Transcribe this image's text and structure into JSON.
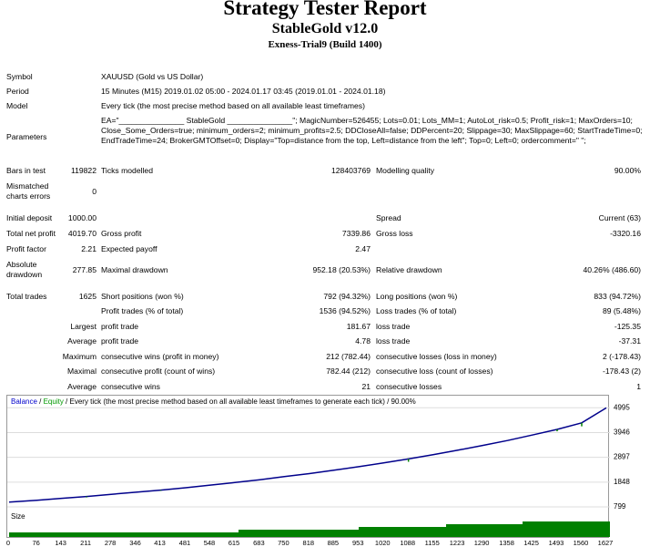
{
  "header": {
    "title": "Strategy Tester Report",
    "subtitle": "StableGold v12.0",
    "build": "Exness-Trial9 (Build 1400)"
  },
  "info": {
    "symbol_label": "Symbol",
    "symbol": "XAUUSD (Gold vs US Dollar)",
    "period_label": "Period",
    "period": "15 Minutes (M15) 2019.01.02 05:00 - 2024.01.17 03:45 (2019.01.01 - 2024.01.18)",
    "model_label": "Model",
    "model": "Every tick (the most precise method based on all available least timeframes)",
    "parameters_label": "Parameters",
    "parameters": "EA=\"_______________ StableGold _______________\"; MagicNumber=526455; Lots=0.01; Lots_MM=1; AutoLot_risk=0.5; Profit_risk=1; MaxOrders=10; Close_Some_Orders=true; minimum_orders=2; minimum_profits=2.5; DDCloseAll=false; DDPercent=20; Slippage=30; MaxSlippage=60; StartTradeTime=0; EndTradeTime=24; BrokerGMTOffset=0; Display=\"Top=distance from the top, Left=distance from the left\"; Top=0; Left=0; ordercomment=\" \";"
  },
  "stats": {
    "bars_label": "Bars in test",
    "bars": "119822",
    "ticks_label": "Ticks modelled",
    "ticks": "128403769",
    "quality_label": "Modelling quality",
    "quality": "90.00%",
    "mismatched_label_1": "Mismatched",
    "mismatched_label_2": "charts errors",
    "mismatched": "0",
    "deposit_label": "Initial deposit",
    "deposit": "1000.00",
    "spread_label": "Spread",
    "spread": "Current (63)",
    "net_label": "Total net profit",
    "net": "4019.70",
    "gross_profit_label": "Gross profit",
    "gross_profit": "7339.86",
    "gross_loss_label": "Gross loss",
    "gross_loss": "-3320.16",
    "pf_label": "Profit factor",
    "pf": "2.21",
    "payoff_label": "Expected payoff",
    "payoff": "2.47",
    "abs_dd_label_1": "Absolute",
    "abs_dd_label_2": "drawdown",
    "abs_dd": "277.85",
    "max_dd_label": "Maximal drawdown",
    "max_dd": "952.18 (20.53%)",
    "rel_dd_label": "Relative drawdown",
    "rel_dd": "40.26% (486.60)",
    "trades_label": "Total trades",
    "trades": "1625",
    "short_label": "Short positions (won %)",
    "short": "792 (94.32%)",
    "long_label": "Long positions (won %)",
    "long": "833 (94.72%)",
    "pt_label": "Profit trades (% of total)",
    "pt": "1536 (94.52%)",
    "lt_label": "Loss trades (% of total)",
    "lt": "89 (5.48%)",
    "largest_label": "Largest",
    "average_label": "Average",
    "maximum_label": "Maximum",
    "maximal_label": "Maximal",
    "profit_trade_label": "profit trade",
    "loss_trade_label": "loss trade",
    "largest_profit": "181.67",
    "largest_loss": "-125.35",
    "average_profit": "4.78",
    "average_loss": "-37.31",
    "cw_label": "consecutive wins (profit in money)",
    "cw": "212 (782.44)",
    "cl_label": "consecutive losses (loss in money)",
    "cl": "2 (-178.43)",
    "cp_label": "consecutive profit (count of wins)",
    "cp": "782.44 (212)",
    "closs_label": "consecutive loss (count of losses)",
    "closs": "-178.43 (2)",
    "acw_label": "consecutive wins",
    "acw": "21",
    "acl_label": "consecutive losses",
    "acl": "1"
  },
  "chart": {
    "legend_balance": "Balance",
    "legend_sep": " / ",
    "legend_equity": "Equity",
    "legend_rest": " / Every tick (the most precise method based on all available least timeframes to generate each tick) / 90.00%",
    "size_label": "Size",
    "line_color": "#00008b",
    "equity_color": "#008000",
    "y_ticks": [
      "4995",
      "3946",
      "2897",
      "1848",
      "799"
    ],
    "x_ticks": [
      "0",
      "76",
      "143",
      "211",
      "278",
      "346",
      "413",
      "481",
      "548",
      "615",
      "683",
      "750",
      "818",
      "885",
      "953",
      "1020",
      "1088",
      "1155",
      "1223",
      "1290",
      "1358",
      "1425",
      "1493",
      "1560",
      "1627"
    ]
  },
  "chart_data": {
    "type": "line",
    "title": "",
    "xlabel": "",
    "ylabel": "",
    "ylim": [
      799,
      5200
    ],
    "xlim": [
      0,
      1627
    ],
    "series": [
      {
        "name": "Balance",
        "x": [
          0,
          76,
          143,
          211,
          278,
          346,
          413,
          481,
          548,
          615,
          683,
          750,
          818,
          885,
          953,
          1020,
          1088,
          1155,
          1223,
          1290,
          1358,
          1425,
          1493,
          1560,
          1627
        ],
        "values": [
          1000,
          1080,
          1160,
          1240,
          1330,
          1420,
          1510,
          1610,
          1720,
          1830,
          1950,
          2080,
          2210,
          2350,
          2500,
          2660,
          2830,
          3010,
          3200,
          3400,
          3610,
          3840,
          4080,
          4360,
          4990
        ]
      }
    ]
  }
}
